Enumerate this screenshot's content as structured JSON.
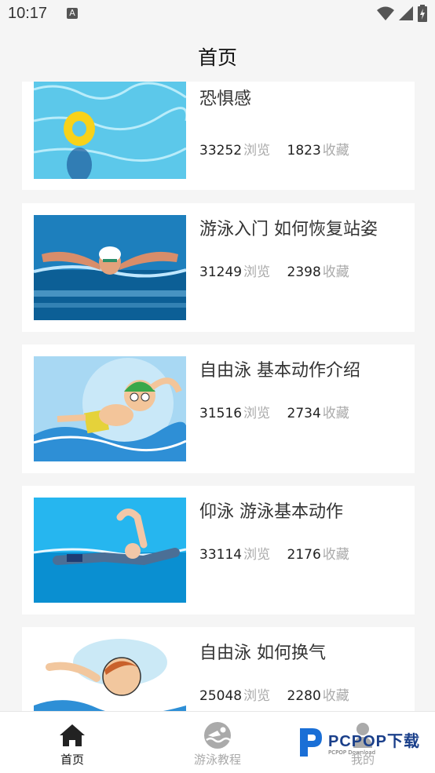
{
  "status": {
    "time": "10:17"
  },
  "header": {
    "title": "首页"
  },
  "articles": [
    {
      "title": "游泳入门 如何克服对水的恐惧感",
      "views": "33252",
      "views_unit": "浏览",
      "favs": "1823",
      "favs_unit": "收藏"
    },
    {
      "title": "游泳入门 如何恢复站姿",
      "views": "31249",
      "views_unit": "浏览",
      "favs": "2398",
      "favs_unit": "收藏"
    },
    {
      "title": "自由泳 基本动作介绍",
      "views": "31516",
      "views_unit": "浏览",
      "favs": "2734",
      "favs_unit": "收藏"
    },
    {
      "title": "仰泳 游泳基本动作",
      "views": "33114",
      "views_unit": "浏览",
      "favs": "2176",
      "favs_unit": "收藏"
    },
    {
      "title": "自由泳 如何换气",
      "views": "25048",
      "views_unit": "浏览",
      "favs": "2280",
      "favs_unit": "收藏"
    }
  ],
  "tabs": [
    {
      "label": "首页",
      "icon": "home-icon",
      "active": true
    },
    {
      "label": "游泳教程",
      "icon": "swim-icon",
      "active": false
    },
    {
      "label": "我的",
      "icon": "profile-icon",
      "active": false
    }
  ],
  "watermark": {
    "brand": "PCPOP下载",
    "sub": "PCPOP Download"
  },
  "colors": {
    "active_tab": "#111111",
    "inactive_tab": "#aaaaaa",
    "unit_text": "#aaaaaa",
    "background": "#f5f5f5"
  }
}
